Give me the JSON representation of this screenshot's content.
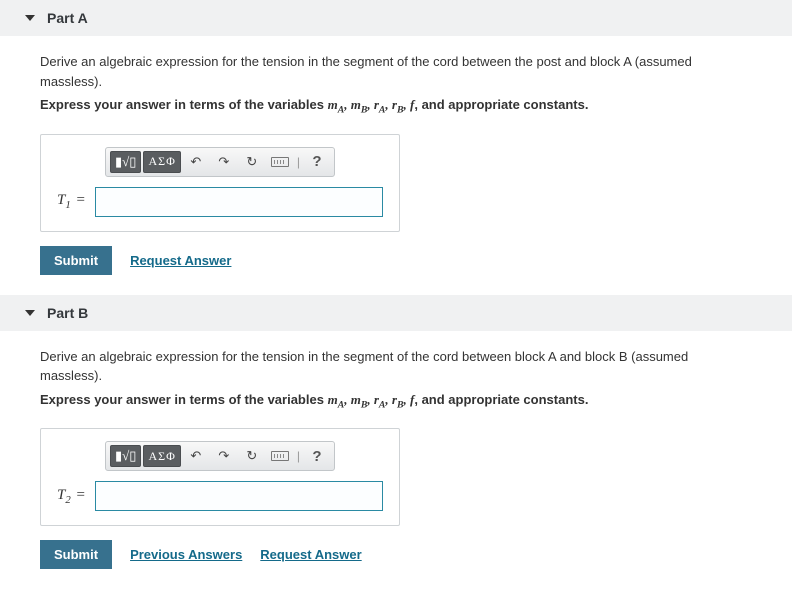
{
  "parts": [
    {
      "title": "Part A",
      "prompt": "Derive an algebraic expression for the tension in the segment of the cord between the post and block A (assumed massless).",
      "expressPrefix": "Express your answer in terms of the variables ",
      "expressSuffix": ", and appropriate constants.",
      "lhs": "T",
      "lhsSub": "1",
      "value": "",
      "actions": {
        "submit": "Submit",
        "request": "Request Answer"
      }
    },
    {
      "title": "Part B",
      "prompt": "Derive an algebraic expression for the tension in the segment of the cord between block A and block B (assumed massless).",
      "expressPrefix": "Express your answer in terms of the variables ",
      "expressSuffix": ", and appropriate constants.",
      "lhs": "T",
      "lhsSub": "2",
      "value": "",
      "actions": {
        "submit": "Submit",
        "previous": "Previous Answers",
        "request": "Request Answer"
      }
    }
  ],
  "toolbar": {
    "template": "Templates",
    "greek": "ΑΣΦ",
    "undo": "↶",
    "redo": "↷",
    "reset": "↻",
    "help": "?"
  },
  "variables_html": "<i>m<sub>A</sub></i>, <i>m<sub>B</sub></i>, <i>r<sub>A</sub></i>, <i>r<sub>B</sub></i>, <i>f</i>"
}
